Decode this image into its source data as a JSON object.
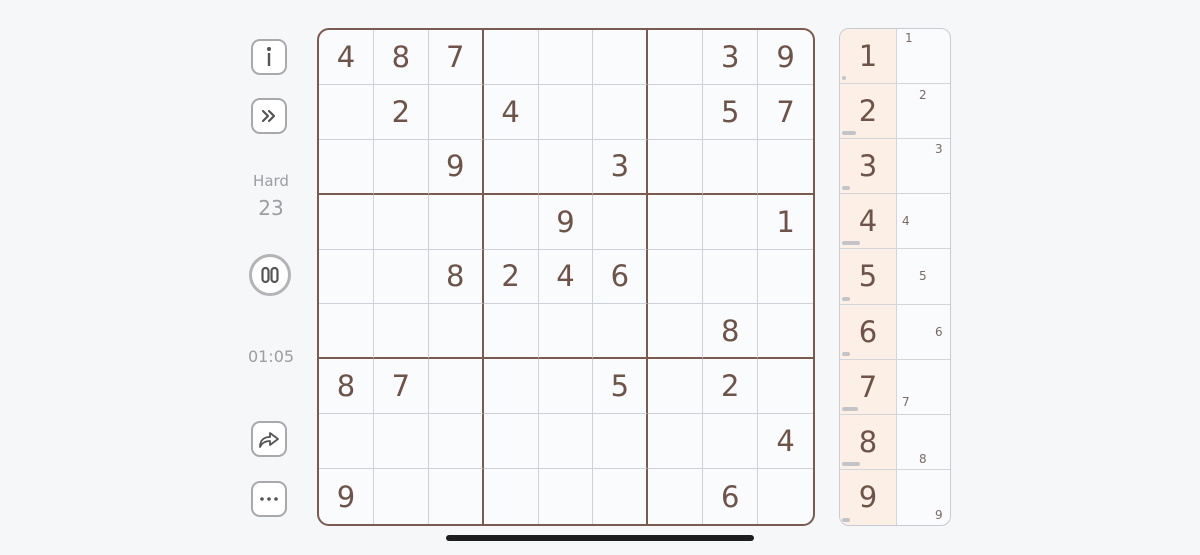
{
  "sidebar": {
    "info_icon": "info-icon",
    "skip_icon": "double-chevron-right-icon",
    "difficulty": "Hard",
    "puzzle_number": "23",
    "pause_icon": "pause-icon",
    "timer": "01:05",
    "share_icon": "share-arrow-icon",
    "more_icon": "ellipsis-icon"
  },
  "board": {
    "rows": [
      [
        "4",
        "8",
        "7",
        "",
        "",
        "",
        "",
        "3",
        "9"
      ],
      [
        "",
        "2",
        "",
        "4",
        "",
        "",
        "",
        "5",
        "7"
      ],
      [
        "",
        "",
        "9",
        "",
        "",
        "3",
        "",
        "",
        ""
      ],
      [
        "",
        "",
        "",
        "",
        "9",
        "",
        "",
        "",
        "1"
      ],
      [
        "",
        "",
        "8",
        "2",
        "4",
        "6",
        "",
        "",
        ""
      ],
      [
        "",
        "",
        "",
        "",
        "",
        "",
        "",
        "8",
        ""
      ],
      [
        "8",
        "7",
        "",
        "",
        "",
        "5",
        "",
        "2",
        ""
      ],
      [
        "",
        "",
        "",
        "",
        "",
        "",
        "",
        "",
        "4"
      ],
      [
        "9",
        "",
        "",
        "",
        "",
        "",
        "",
        "6",
        ""
      ]
    ]
  },
  "palette": {
    "numbers": [
      "1",
      "2",
      "3",
      "4",
      "5",
      "6",
      "7",
      "8",
      "9"
    ],
    "progress": [
      0.1,
      0.35,
      0.2,
      0.45,
      0.2,
      0.2,
      0.4,
      0.45,
      0.2
    ],
    "note_labels": [
      "1",
      "2",
      "3",
      "4",
      "5",
      "6",
      "7",
      "8",
      "9"
    ]
  },
  "colors": {
    "accent": "#7b5b50",
    "digit": "#6e5348",
    "palette_bg": "#fbefe6",
    "background": "#f6f7f9"
  }
}
